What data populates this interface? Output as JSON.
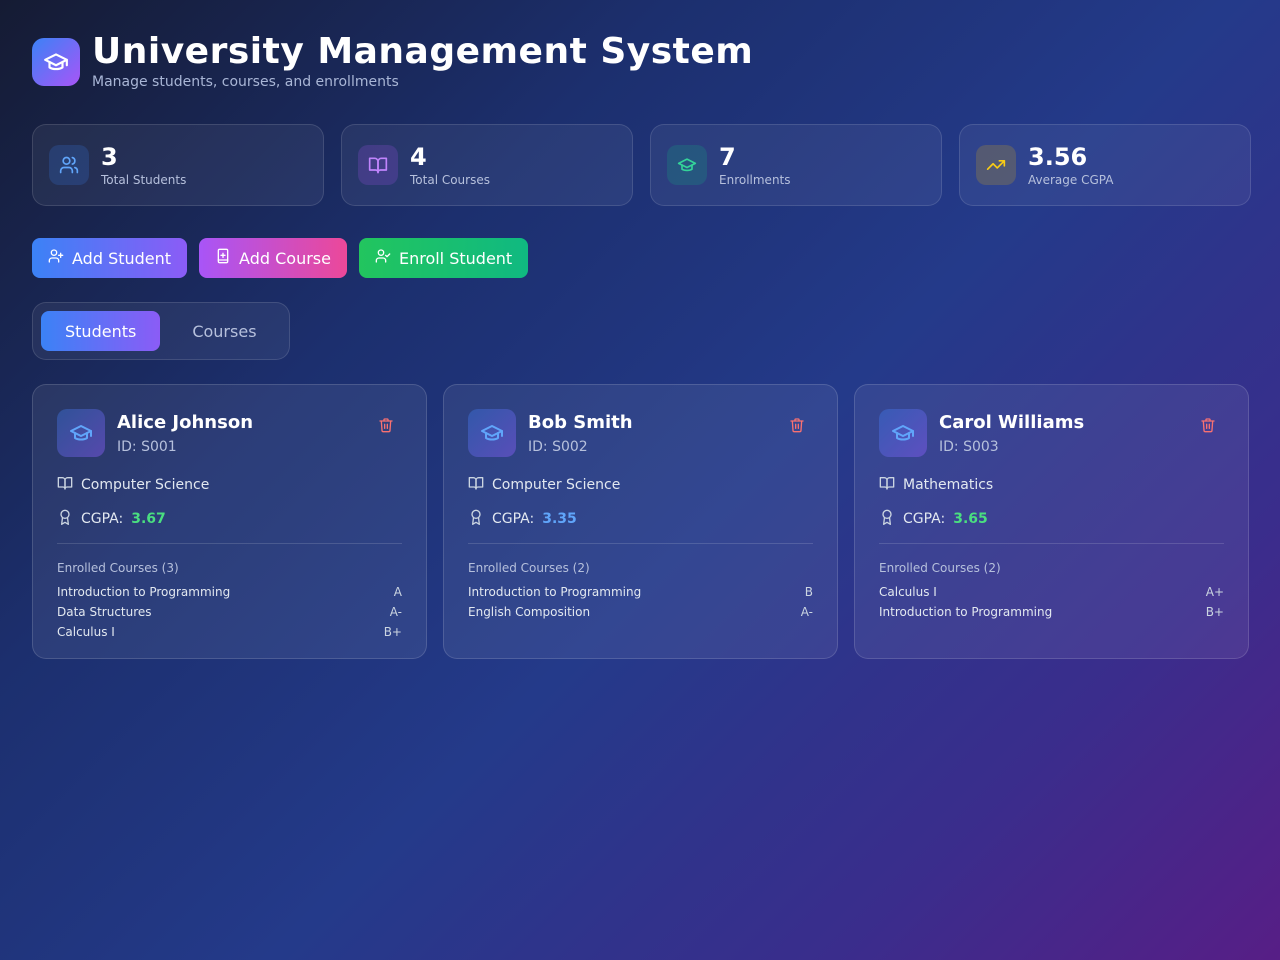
{
  "header": {
    "title": "University Management System",
    "subtitle": "Manage students, courses, and enrollments"
  },
  "stats": [
    {
      "value": "3",
      "label": "Total Students",
      "icon": "users-icon",
      "color": "#60a5fa",
      "bg": "rgba(59,130,246,0.2)"
    },
    {
      "value": "4",
      "label": "Total Courses",
      "icon": "book-icon",
      "color": "#c084fc",
      "bg": "rgba(168,85,247,0.2)"
    },
    {
      "value": "7",
      "label": "Enrollments",
      "icon": "graduation-cap-icon",
      "color": "#34d399",
      "bg": "rgba(16,185,129,0.2)"
    },
    {
      "value": "3.56",
      "label": "Average CGPA",
      "icon": "trending-up-icon",
      "color": "#facc15",
      "bg": "rgba(234,179,8,0.2)"
    }
  ],
  "actions": {
    "add_student": "Add Student",
    "add_course": "Add Course",
    "enroll_student": "Enroll Student"
  },
  "tabs": {
    "students": "Students",
    "courses": "Courses"
  },
  "students": [
    {
      "name": "Alice Johnson",
      "id": "ID: S001",
      "major": "Computer Science",
      "cgpa_label": "CGPA:",
      "cgpa": "3.67",
      "cgpa_color": "#4ade80",
      "enrolled_title": "Enrolled Courses (3)",
      "courses": [
        {
          "name": "Introduction to Programming",
          "grade": "A"
        },
        {
          "name": "Data Structures",
          "grade": "A-"
        },
        {
          "name": "Calculus I",
          "grade": "B+"
        }
      ]
    },
    {
      "name": "Bob Smith",
      "id": "ID: S002",
      "major": "Computer Science",
      "cgpa_label": "CGPA:",
      "cgpa": "3.35",
      "cgpa_color": "#60a5fa",
      "enrolled_title": "Enrolled Courses (2)",
      "courses": [
        {
          "name": "Introduction to Programming",
          "grade": "B"
        },
        {
          "name": "English Composition",
          "grade": "A-"
        }
      ]
    },
    {
      "name": "Carol Williams",
      "id": "ID: S003",
      "major": "Mathematics",
      "cgpa_label": "CGPA:",
      "cgpa": "3.65",
      "cgpa_color": "#4ade80",
      "enrolled_title": "Enrolled Courses (2)",
      "courses": [
        {
          "name": "Calculus I",
          "grade": "A+"
        },
        {
          "name": "Introduction to Programming",
          "grade": "B+"
        }
      ]
    }
  ]
}
